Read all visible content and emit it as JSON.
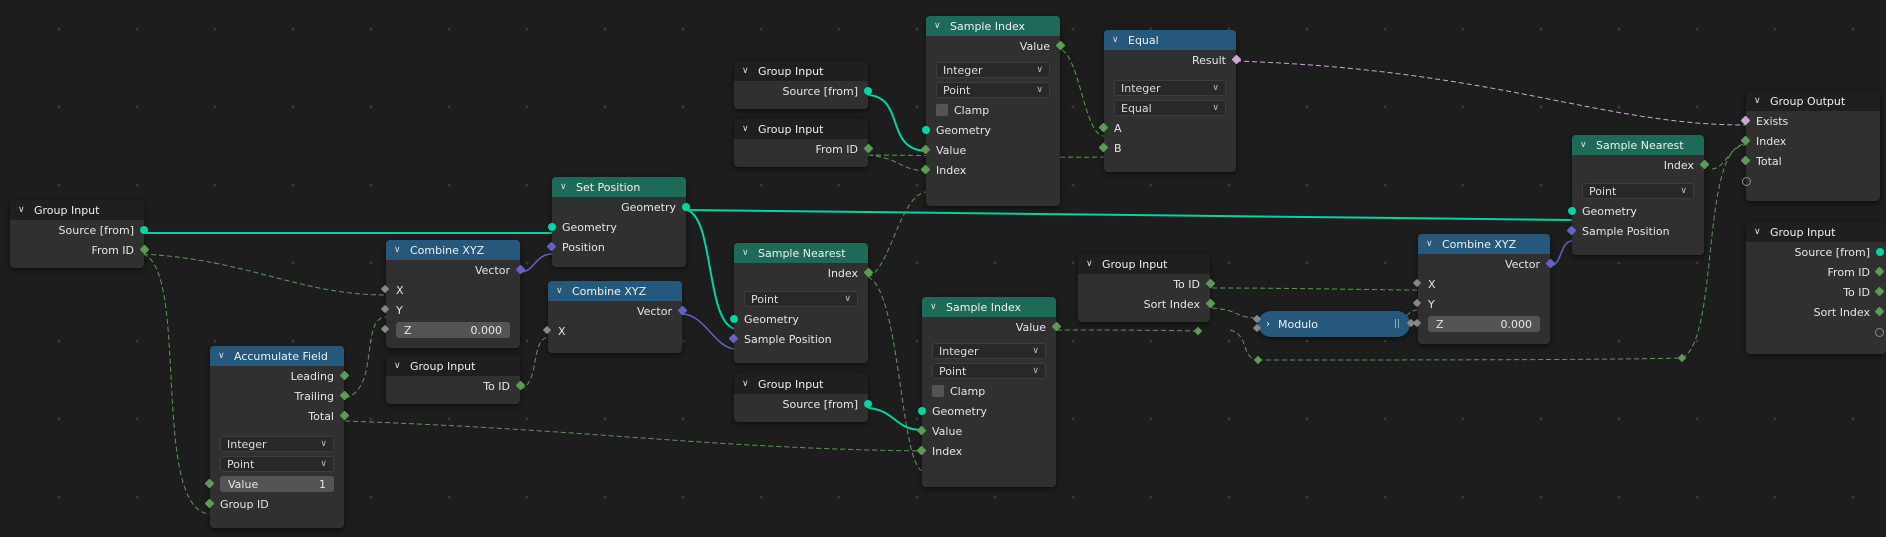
{
  "nodes": {
    "gi1": {
      "title": "Group Input",
      "outputs": [
        "Source [from]",
        "From ID"
      ]
    },
    "combine1": {
      "title": "Combine XYZ",
      "output": "Vector",
      "inputs": [
        "X",
        "Y"
      ],
      "z_label": "Z",
      "z_value": "0.000"
    },
    "accum": {
      "title": "Accumulate Field",
      "outputs": [
        "Leading",
        "Trailing",
        "Total"
      ],
      "type": "Integer",
      "domain": "Point",
      "value_label": "Value",
      "value": "1",
      "group_id": "Group ID"
    },
    "gi_toid": {
      "title": "Group Input",
      "output": "To ID"
    },
    "setpos": {
      "title": "Set Position",
      "output": "Geometry",
      "inputs": [
        "Geometry",
        "Position"
      ]
    },
    "combine2": {
      "title": "Combine XYZ",
      "output": "Vector",
      "inputs": [
        "X"
      ]
    },
    "gi_src2": {
      "title": "Group Input",
      "output": "Source [from]"
    },
    "gi_fromid2": {
      "title": "Group Input",
      "output": "From ID"
    },
    "snear1": {
      "title": "Sample Nearest",
      "output": "Index",
      "domain": "Point",
      "inputs": [
        "Geometry",
        "Sample Position"
      ]
    },
    "gi_src3": {
      "title": "Group Input",
      "output": "Source [from]"
    },
    "sidx1": {
      "title": "Sample Index",
      "output": "Value",
      "type": "Integer",
      "domain": "Point",
      "clamp": "Clamp",
      "inputs": [
        "Geometry",
        "Value",
        "Index"
      ]
    },
    "equal": {
      "title": "Equal",
      "output": "Result",
      "type": "Integer",
      "mode": "Equal",
      "inputs": [
        "A",
        "B"
      ]
    },
    "sidx2": {
      "title": "Sample Index",
      "output": "Value",
      "type": "Integer",
      "domain": "Point",
      "clamp": "Clamp",
      "inputs": [
        "Geometry",
        "Value",
        "Index"
      ]
    },
    "gi_right": {
      "title": "Group Input",
      "outputs": [
        "To ID",
        "Sort Index"
      ]
    },
    "modulo": {
      "title": "Modulo"
    },
    "combine3": {
      "title": "Combine XYZ",
      "output": "Vector",
      "inputs": [
        "X",
        "Y"
      ],
      "z_label": "Z",
      "z_value": "0.000"
    },
    "snear2": {
      "title": "Sample Nearest",
      "output": "Index",
      "domain": "Point",
      "inputs": [
        "Geometry",
        "Sample Position"
      ]
    },
    "gout": {
      "title": "Group Output",
      "inputs": [
        "Exists",
        "Index",
        "Total"
      ]
    },
    "gi_far": {
      "title": "Group Input",
      "outputs": [
        "Source [from]",
        "From ID",
        "To ID",
        "Sort Index"
      ]
    }
  },
  "colors": {
    "geometry": "#00d6a3",
    "integer": "#5b9b55",
    "vector": "#6363c7",
    "boolean": "#cca6d6"
  }
}
